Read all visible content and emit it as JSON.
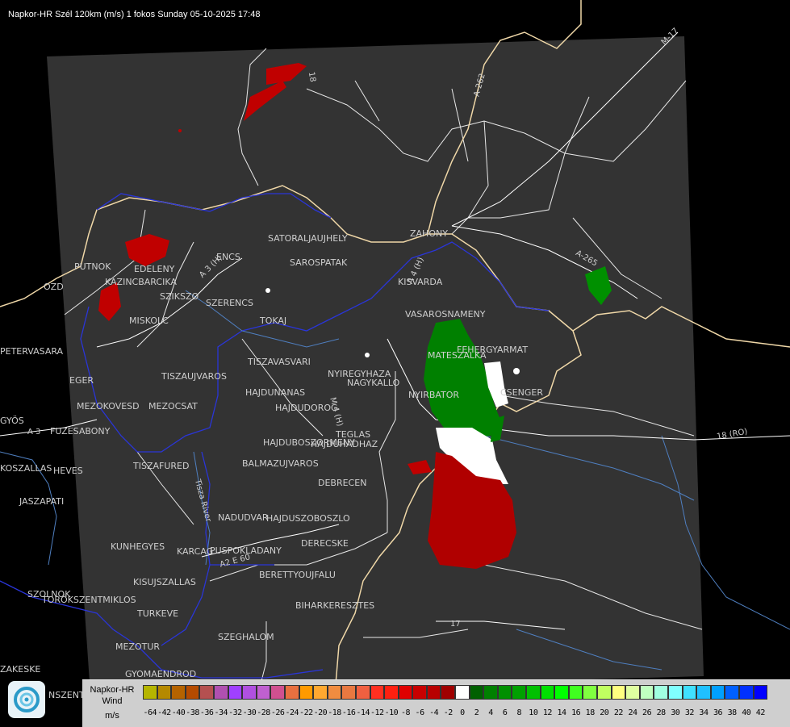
{
  "header": {
    "title": "Napkor-HR Szél 120km (m/s) 1 fokos Sunday 05-10-2025 17:48"
  },
  "places": [
    {
      "name": "SATORALJAUJHELY"
    },
    {
      "name": "SAROSPATAK"
    },
    {
      "name": "ZAHONY"
    },
    {
      "name": "KISVARDA"
    },
    {
      "name": "VASAROSNAMENY"
    },
    {
      "name": "FEHERGYARMAT"
    },
    {
      "name": "MATESZALKA"
    },
    {
      "name": "CSENGER"
    },
    {
      "name": "NYIRBATOR"
    },
    {
      "name": "PUTNOK"
    },
    {
      "name": "EDELENY"
    },
    {
      "name": "KAZINCBARCIKA"
    },
    {
      "name": "SZIKSZO"
    },
    {
      "name": "SZERENCS"
    },
    {
      "name": "ENCS"
    },
    {
      "name": "TOKAJ"
    },
    {
      "name": "MISKOLC"
    },
    {
      "name": "OZD"
    },
    {
      "name": "PETERVASARA"
    },
    {
      "name": "EGER"
    },
    {
      "name": "TISZAUJVAROS"
    },
    {
      "name": "TISZAVASVARI"
    },
    {
      "name": "NYIREGYHAZA"
    },
    {
      "name": "NAGYKALLO"
    },
    {
      "name": "HAJDUNANAS"
    },
    {
      "name": "HAJDUDOROG"
    },
    {
      "name": "MEZOKOVESD"
    },
    {
      "name": "MEZOCSAT"
    },
    {
      "name": "GYÖS"
    },
    {
      "name": "FUZESABONY"
    },
    {
      "name": "HAJDUBOSZORMENY"
    },
    {
      "name": "HAJDUHADHAZ"
    },
    {
      "name": "TEGLAS"
    },
    {
      "name": "BALMAZUJVAROS"
    },
    {
      "name": "TISZAFURED"
    },
    {
      "name": "HEVES"
    },
    {
      "name": "DEBRECEN"
    },
    {
      "name": "KOSZALLAS"
    },
    {
      "name": "JASZAPATI"
    },
    {
      "name": "NADUDVAR"
    },
    {
      "name": "HAJDUSZOBOSZLO"
    },
    {
      "name": "KUNHEGYES"
    },
    {
      "name": "KARCAG"
    },
    {
      "name": "PUSPOKLADANY"
    },
    {
      "name": "DERECSKE"
    },
    {
      "name": "KISUJSZALLAS"
    },
    {
      "name": "BERETTYOUJFALU"
    },
    {
      "name": "SZOLNOK"
    },
    {
      "name": "TORÖKSZENTMIKLOS"
    },
    {
      "name": "TURKEVE"
    },
    {
      "name": "BIHARKERESZTES"
    },
    {
      "name": "SZEGHALOM"
    },
    {
      "name": "MEZOTUR"
    },
    {
      "name": "ZAKESKE"
    },
    {
      "name": "GYOMAENDROD"
    },
    {
      "name": "NSZENTMARTON"
    }
  ],
  "roads": [
    {
      "name": "M-17"
    },
    {
      "name": "A-262"
    },
    {
      "name": "18"
    },
    {
      "name": "A-265"
    },
    {
      "name": "A 3 (H)"
    },
    {
      "name": "A 4 (H)"
    },
    {
      "name": "A 3"
    },
    {
      "name": "18 (RO)"
    },
    {
      "name": "A2 E 60"
    },
    {
      "name": "Tisza River"
    },
    {
      "name": "17"
    },
    {
      "name": "M 4 (H)"
    }
  ],
  "legend": {
    "title": "Napkor-HR",
    "subtitle": "Wind",
    "unit": "m/s",
    "colors": [
      "#b5b500",
      "#b58900",
      "#b56300",
      "#b54b00",
      "#b55050",
      "#b050b0",
      "#a040ff",
      "#b050e0",
      "#c060d0",
      "#d05090",
      "#e87040",
      "#ff9a00",
      "#ffa830",
      "#f08c40",
      "#e87840",
      "#f06040",
      "#ff3020",
      "#ff2010",
      "#e00000",
      "#c80000",
      "#b80000",
      "#a00000",
      "#ffffff",
      "#006000",
      "#008000",
      "#009000",
      "#00a000",
      "#00c000",
      "#00e000",
      "#00ff00",
      "#40ff20",
      "#80ff40",
      "#c0ff60",
      "#ffff80",
      "#e0ffa0",
      "#c0ffc0",
      "#a0ffe0",
      "#80ffff",
      "#40e0ff",
      "#20c0ff",
      "#00a0ff",
      "#0060ff",
      "#0030ff",
      "#0000ff"
    ],
    "ticks": [
      "-64",
      "-42",
      "-40",
      "-38",
      "-36",
      "-34",
      "-32",
      "-30",
      "-28",
      "-26",
      "-24",
      "-22",
      "-20",
      "-18",
      "-16",
      "-14",
      "-12",
      "-10",
      "-8",
      "-6",
      "-4",
      "-2",
      "0",
      "2",
      "4",
      "6",
      "8",
      "10",
      "12",
      "14",
      "16",
      "18",
      "20",
      "22",
      "24",
      "26",
      "28",
      "30",
      "32",
      "34",
      "36",
      "38",
      "40",
      "42"
    ]
  }
}
